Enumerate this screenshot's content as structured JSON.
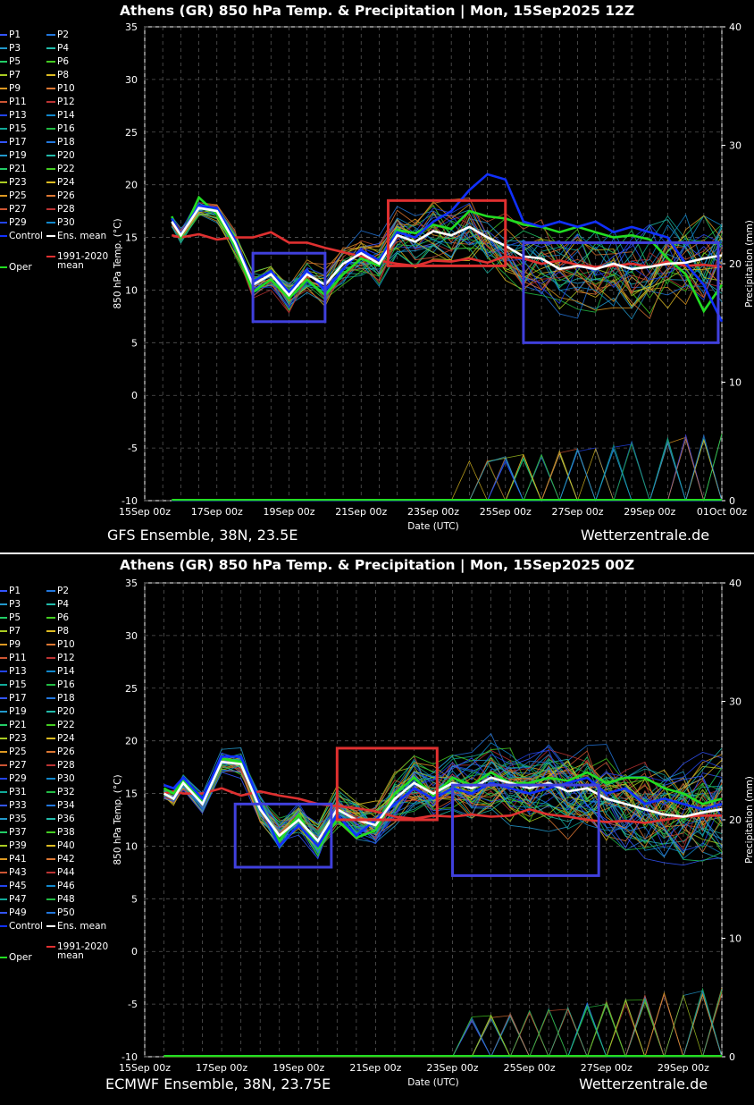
{
  "panels": [
    {
      "title": "Athens  (GR)  850 hPa Temp. & Precipitation | Mon, 15Sep2025 12Z",
      "footer_model": "GFS Ensemble, 38N, 23.5E",
      "footer_site": "Wetterzentrale.de",
      "legend_members": [
        "P1",
        "P2",
        "P3",
        "P4",
        "P5",
        "P6",
        "P7",
        "P8",
        "P9",
        "P10",
        "P11",
        "P12",
        "P13",
        "P14",
        "P15",
        "P16",
        "P17",
        "P18",
        "P19",
        "P20",
        "P21",
        "P22",
        "P23",
        "P24",
        "P25",
        "P26",
        "P27",
        "P28",
        "P29",
        "P30"
      ],
      "legend_control": "Control",
      "legend_mean": "Ens. mean",
      "legend_clim": "1991-2020",
      "legend_clim2": "mean",
      "legend_oper": "Oper"
    },
    {
      "title": "Athens  (GR)  850 hPa Temp. & Precipitation | Mon, 15Sep2025 00Z",
      "footer_model": "ECMWF Ensemble, 38N, 23.75E",
      "footer_site": "Wetterzentrale.de",
      "legend_members": [
        "P1",
        "P2",
        "P3",
        "P4",
        "P5",
        "P6",
        "P7",
        "P8",
        "P9",
        "P10",
        "P11",
        "P12",
        "P13",
        "P14",
        "P15",
        "P16",
        "P17",
        "P18",
        "P19",
        "P20",
        "P21",
        "P22",
        "P23",
        "P24",
        "P25",
        "P26",
        "P27",
        "P28",
        "P29",
        "P30",
        "P31",
        "P32",
        "P33",
        "P34",
        "P35",
        "P36",
        "P37",
        "P38",
        "P39",
        "P40",
        "P41",
        "P42",
        "P43",
        "P44",
        "P45",
        "P46",
        "P47",
        "P48",
        "P49",
        "P50"
      ],
      "legend_control": "Control",
      "legend_mean": "Ens. mean",
      "legend_clim": "1991-2020",
      "legend_clim2": "mean",
      "legend_oper": "Oper"
    }
  ],
  "chart_data": [
    {
      "type": "line",
      "title": "Athens  (GR)  850 hPa Temp. & Precipitation | Mon, 15Sep2025 12Z",
      "xlabel": "Date (UTC)",
      "ylabel": "850 hPa Temp. (°C)",
      "y2label": "Precipitation (mm)",
      "ylim": [
        -10,
        35
      ],
      "y2lim": [
        0,
        40
      ],
      "yticks": [
        -10,
        -5,
        0,
        5,
        10,
        15,
        20,
        25,
        30,
        35
      ],
      "y2ticks": [
        0,
        10,
        20,
        30,
        40
      ],
      "xticks": [
        "15Sep 00z",
        "17Sep 00z",
        "19Sep 00z",
        "21Sep 00z",
        "23Sep 00z",
        "25Sep 00z",
        "27Sep 00z",
        "29Sep 00z",
        "01Oct 00z"
      ],
      "x_days": [
        0,
        16
      ],
      "grid": true,
      "series": [
        {
          "name": "Ens. mean",
          "color": "#ffffff",
          "x": [
            0.75,
            1,
            1.5,
            2,
            2.5,
            3,
            3.5,
            4,
            4.5,
            5,
            5.5,
            6,
            6.5,
            7,
            7.5,
            8,
            8.5,
            9,
            9.5,
            10,
            10.5,
            11,
            11.5,
            12,
            12.5,
            13,
            13.5,
            14,
            14.5,
            15,
            15.5,
            16
          ],
          "values": [
            16.5,
            15.2,
            17.8,
            17.5,
            14.5,
            10.5,
            11.5,
            9.5,
            11.5,
            10.5,
            12.5,
            13.5,
            12.5,
            15.2,
            14.6,
            15.6,
            15.2,
            16.0,
            15.0,
            14.2,
            13.2,
            13.0,
            12.0,
            12.3,
            12.0,
            12.5,
            12.0,
            12.2,
            12.5,
            12.6,
            13.0,
            13.3
          ]
        },
        {
          "name": "Control",
          "color": "#1030ff",
          "x": [
            0.75,
            1,
            1.5,
            2,
            2.5,
            3,
            3.5,
            4,
            4.5,
            5,
            5.5,
            6,
            6.5,
            7,
            7.5,
            8,
            8.5,
            9,
            9.5,
            10,
            10.5,
            11,
            11.5,
            12,
            12.5,
            13,
            13.5,
            14,
            14.5,
            15,
            15.5,
            16
          ],
          "values": [
            16.8,
            15.3,
            18.0,
            17.8,
            14.8,
            10.8,
            11.8,
            9.8,
            11.8,
            10.0,
            12.0,
            13.8,
            12.8,
            15.5,
            15.0,
            16.5,
            17.5,
            19.5,
            21.0,
            20.5,
            16.5,
            16.0,
            16.5,
            16.0,
            16.5,
            15.5,
            16.0,
            15.5,
            15.0,
            12.5,
            10.5,
            7.0
          ]
        },
        {
          "name": "Oper",
          "color": "#22dd22",
          "x": [
            0.75,
            1,
            1.5,
            2,
            2.5,
            3,
            3.5,
            4,
            4.5,
            5,
            5.5,
            6,
            6.5,
            7,
            7.5,
            8,
            8.5,
            9,
            9.5,
            10,
            10.5,
            11,
            11.5,
            12,
            12.5,
            13,
            13.5,
            14,
            14.5,
            15,
            15.5,
            16
          ],
          "values": [
            17.0,
            15.0,
            18.8,
            17.2,
            14.2,
            9.8,
            11.0,
            9.2,
            11.0,
            9.5,
            11.5,
            13.0,
            12.3,
            15.7,
            15.4,
            16.2,
            15.8,
            17.5,
            17.0,
            16.8,
            16.2,
            16.0,
            15.5,
            16.0,
            15.5,
            15.0,
            15.2,
            14.8,
            13.0,
            11.5,
            8.0,
            10.5
          ]
        },
        {
          "name": "1991-2020 mean",
          "color": "#e03030",
          "x": [
            0.75,
            1,
            1.5,
            2,
            2.5,
            3,
            3.5,
            4,
            4.5,
            5,
            5.5,
            6,
            6.5,
            7,
            7.5,
            8,
            8.5,
            9,
            9.5,
            10,
            10.5,
            11,
            11.5,
            12,
            12.5,
            13,
            13.5,
            14,
            14.5,
            15,
            15.5,
            16
          ],
          "values": [
            15.2,
            15.0,
            15.3,
            14.8,
            15.0,
            15.0,
            15.5,
            14.5,
            14.5,
            14.0,
            13.6,
            13.2,
            12.8,
            12.5,
            12.3,
            12.8,
            12.7,
            13.0,
            12.6,
            13.2,
            13.0,
            12.5,
            12.8,
            12.4,
            12.2,
            12.3,
            12.5,
            12.2,
            12.7,
            12.3,
            12.4,
            12.2
          ]
        }
      ],
      "boxes": [
        {
          "color": "#4040dd",
          "x": [
            3.0,
            5.0
          ],
          "y": [
            7.0,
            13.5
          ]
        },
        {
          "color": "#e03030",
          "x": [
            6.75,
            10.0
          ],
          "y": [
            12.3,
            18.5
          ]
        },
        {
          "color": "#4040dd",
          "x": [
            10.5,
            15.9
          ],
          "y": [
            5.0,
            14.5
          ]
        }
      ]
    },
    {
      "type": "line",
      "title": "Athens  (GR)  850 hPa Temp. & Precipitation | Mon, 15Sep2025 00Z",
      "xlabel": "Date (UTC)",
      "ylabel": "850 hPa Temp. (°C)",
      "y2label": "Precipitation (mm)",
      "ylim": [
        -10,
        35
      ],
      "y2lim": [
        0,
        40
      ],
      "yticks": [
        -10,
        -5,
        0,
        5,
        10,
        15,
        20,
        25,
        30,
        35
      ],
      "y2ticks": [
        0,
        10,
        20,
        30,
        40
      ],
      "xticks": [
        "15Sep 00z",
        "17Sep 00z",
        "19Sep 00z",
        "21Sep 00z",
        "23Sep 00z",
        "25Sep 00z",
        "27Sep 00z",
        "29Sep 00z"
      ],
      "x_days": [
        0,
        15
      ],
      "grid": true,
      "series": [
        {
          "name": "Ens. mean",
          "color": "#ffffff",
          "x": [
            0.5,
            0.75,
            1,
            1.5,
            2,
            2.5,
            3,
            3.5,
            4,
            4.5,
            5,
            5.5,
            6,
            6.5,
            7,
            7.5,
            8,
            8.5,
            9,
            9.5,
            10,
            10.5,
            11,
            11.5,
            12,
            12.5,
            13,
            13.5,
            14,
            14.5,
            15
          ],
          "values": [
            15.0,
            14.5,
            16.0,
            14.0,
            18.0,
            17.8,
            13.5,
            11.0,
            12.5,
            10.5,
            13.5,
            12.5,
            12.0,
            14.5,
            16.0,
            15.0,
            16.0,
            15.5,
            16.5,
            16.0,
            15.5,
            16.0,
            15.2,
            15.5,
            14.5,
            14.0,
            13.5,
            13.0,
            12.8,
            13.2,
            13.5
          ]
        },
        {
          "name": "Control",
          "color": "#1030ff",
          "x": [
            0.5,
            0.75,
            1,
            1.5,
            2,
            2.5,
            3,
            3.5,
            4,
            4.5,
            5,
            5.5,
            6,
            6.5,
            7,
            7.5,
            8,
            8.5,
            9,
            9.5,
            10,
            10.5,
            11,
            11.5,
            12,
            12.5,
            13,
            13.5,
            14,
            14.5,
            15
          ],
          "values": [
            15.8,
            15.5,
            16.5,
            14.5,
            18.5,
            18.5,
            14.0,
            10.0,
            12.0,
            10.0,
            13.0,
            11.0,
            12.5,
            14.0,
            15.5,
            14.5,
            15.5,
            15.0,
            16.0,
            15.5,
            15.0,
            15.5,
            16.0,
            16.5,
            15.0,
            15.5,
            14.0,
            14.5,
            14.0,
            13.5,
            14.0
          ]
        },
        {
          "name": "Oper",
          "color": "#22dd22",
          "x": [
            0.5,
            0.75,
            1,
            1.5,
            2,
            2.5,
            3,
            3.5,
            4,
            4.5,
            5,
            5.5,
            6,
            6.5,
            7,
            7.5,
            8,
            8.5,
            9,
            9.5,
            10,
            10.5,
            11,
            11.5,
            12,
            12.5,
            13,
            13.5,
            14,
            14.5,
            15
          ],
          "values": [
            15.5,
            15.0,
            16.2,
            14.2,
            18.3,
            18.0,
            13.8,
            10.5,
            13.0,
            9.8,
            12.5,
            10.8,
            11.5,
            15.0,
            16.5,
            14.8,
            16.5,
            15.8,
            17.0,
            16.0,
            16.0,
            16.5,
            16.2,
            17.0,
            16.0,
            16.5,
            16.5,
            15.5,
            15.0,
            14.0,
            14.5
          ]
        },
        {
          "name": "1991-2020 mean",
          "color": "#e03030",
          "x": [
            0.5,
            0.75,
            1,
            1.5,
            2,
            2.5,
            3,
            3.5,
            4,
            4.5,
            5,
            5.5,
            6,
            6.5,
            7,
            7.5,
            8,
            8.5,
            9,
            9.5,
            10,
            10.5,
            11,
            11.5,
            12,
            12.5,
            13,
            13.5,
            14,
            14.5,
            15
          ],
          "values": [
            15.0,
            15.2,
            15.0,
            15.0,
            15.5,
            14.8,
            15.2,
            14.8,
            14.5,
            14.0,
            13.8,
            13.6,
            13.3,
            12.8,
            12.6,
            12.9,
            12.8,
            13.0,
            12.8,
            12.9,
            13.5,
            13.0,
            12.8,
            12.5,
            12.3,
            12.4,
            12.2,
            12.5,
            12.8,
            12.9,
            12.9
          ]
        }
      ],
      "boxes": [
        {
          "color": "#4040dd",
          "x": [
            2.35,
            4.85
          ],
          "y": [
            8.0,
            14.0
          ]
        },
        {
          "color": "#e03030",
          "x": [
            5.0,
            7.6
          ],
          "y": [
            12.5,
            19.3
          ]
        },
        {
          "color": "#4040dd",
          "x": [
            8.0,
            11.8
          ],
          "y": [
            7.2,
            15.8
          ]
        }
      ]
    }
  ]
}
